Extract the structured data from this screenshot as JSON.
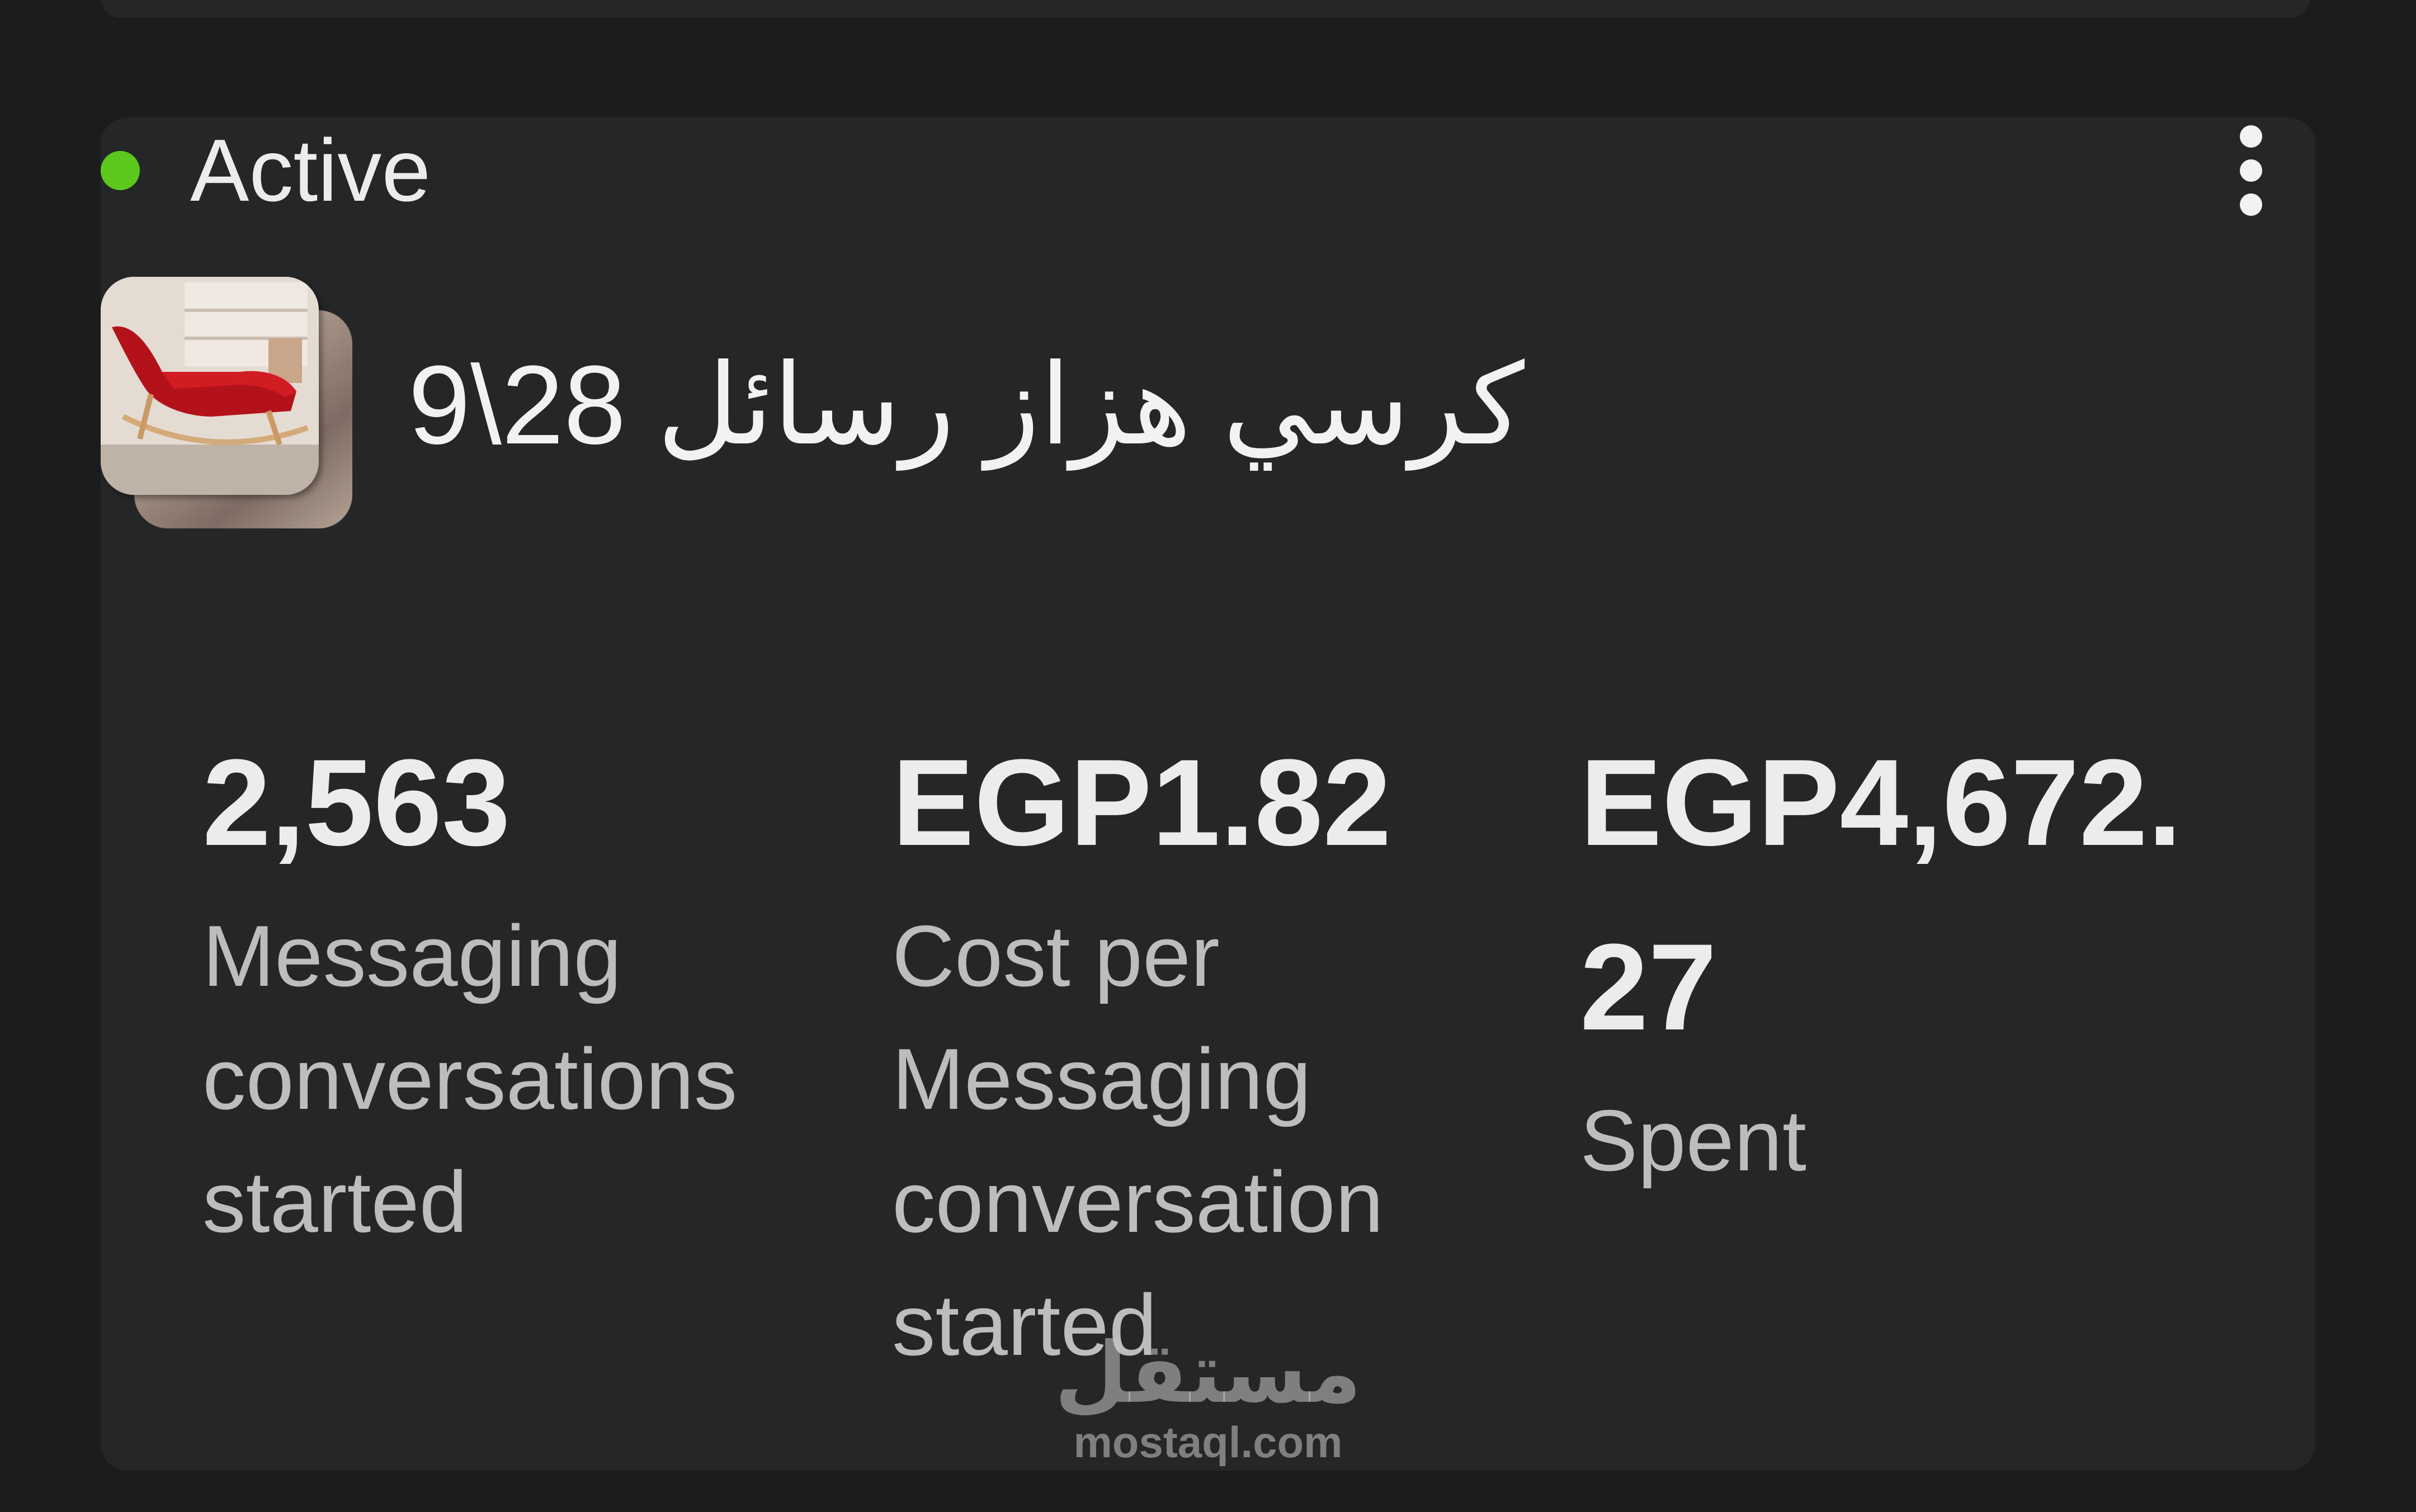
{
  "status": {
    "label": "Active",
    "color": "#5cc81e"
  },
  "menu": {
    "icon": "more-vertical-icon"
  },
  "ad": {
    "title": "كرسي هزاز رسائل 28\\9",
    "thumbnail_icon": "rocking-chair-image"
  },
  "metrics": [
    {
      "value": "2,563",
      "label": "Messaging conversations started"
    },
    {
      "value": "EGP1.82",
      "label": "Cost per Messaging conversation started"
    },
    {
      "value": "EGP4,672.27",
      "label": "Spent"
    }
  ],
  "watermark": {
    "arabic": "مستقل",
    "latin": "mostaql.com"
  }
}
